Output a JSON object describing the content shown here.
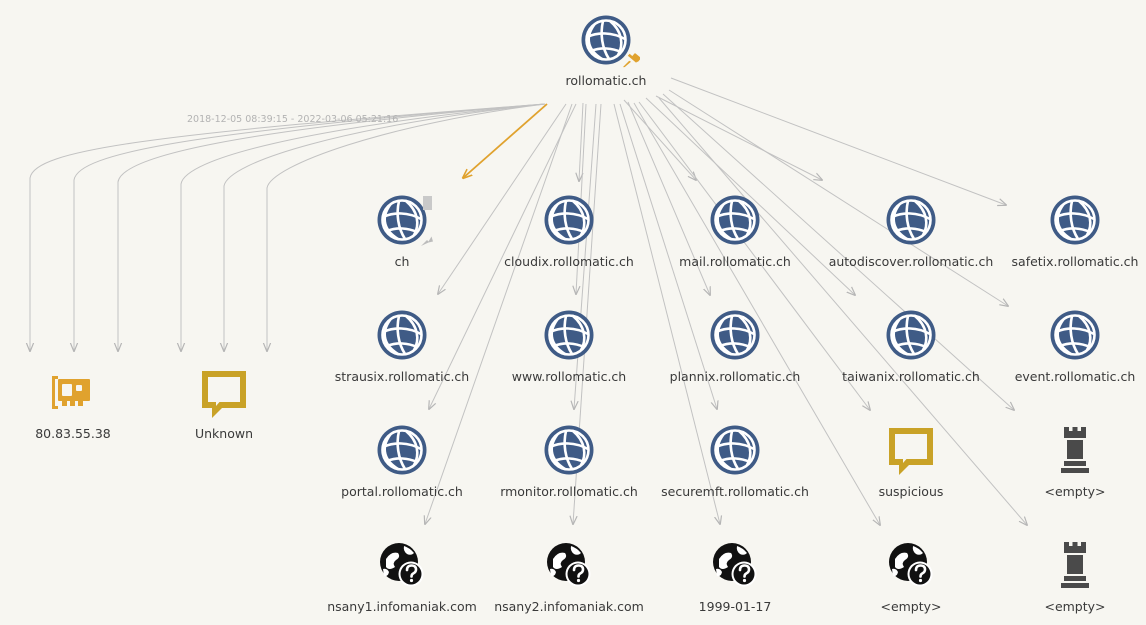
{
  "graph": {
    "root": {
      "label": "rollomatic.ch",
      "icon": "domain-globe-icon",
      "pinned": true
    },
    "edge_label": "2018-12-05 08:39:15 - 2022-03-06 05:21:16",
    "nodes": [
      {
        "label": "80.83.55.38",
        "icon": "network-card-icon"
      },
      {
        "label": "Unknown",
        "icon": "comment-icon"
      },
      {
        "label": "ch",
        "icon": "domain-globe-icon"
      },
      {
        "label": "cloudix.rollomatic.ch",
        "icon": "domain-globe-icon"
      },
      {
        "label": "mail.rollomatic.ch",
        "icon": "domain-globe-icon"
      },
      {
        "label": "autodiscover.rollomatic.ch",
        "icon": "domain-globe-icon"
      },
      {
        "label": "safetix.rollomatic.ch",
        "icon": "domain-globe-icon"
      },
      {
        "label": "strausix.rollomatic.ch",
        "icon": "domain-globe-icon"
      },
      {
        "label": "www.rollomatic.ch",
        "icon": "domain-globe-icon"
      },
      {
        "label": "plannix.rollomatic.ch",
        "icon": "domain-globe-icon"
      },
      {
        "label": "taiwanix.rollomatic.ch",
        "icon": "domain-globe-icon"
      },
      {
        "label": "event.rollomatic.ch",
        "icon": "domain-globe-icon"
      },
      {
        "label": "portal.rollomatic.ch",
        "icon": "domain-globe-icon"
      },
      {
        "label": "rmonitor.rollomatic.ch",
        "icon": "domain-globe-icon"
      },
      {
        "label": "securemft.rollomatic.ch",
        "icon": "domain-globe-icon"
      },
      {
        "label": "suspicious",
        "icon": "comment-icon"
      },
      {
        "label": "<empty>",
        "icon": "rook-icon"
      },
      {
        "label": "nsany1.infomaniak.com",
        "icon": "unknown-globe-icon"
      },
      {
        "label": "nsany2.infomaniak.com",
        "icon": "unknown-globe-icon"
      },
      {
        "label": "1999-01-17",
        "icon": "unknown-globe-icon"
      },
      {
        "label": "<empty>",
        "icon": "unknown-globe-icon"
      },
      {
        "label": "<empty>",
        "icon": "rook-icon"
      }
    ]
  },
  "colors": {
    "background": "#f7f6f1",
    "globe": "#3f5b86",
    "accent_orange": "#e0a22e",
    "comment_gold": "#c9a227",
    "edge": "#bdbdbd",
    "rook": "#4a4a4a"
  }
}
